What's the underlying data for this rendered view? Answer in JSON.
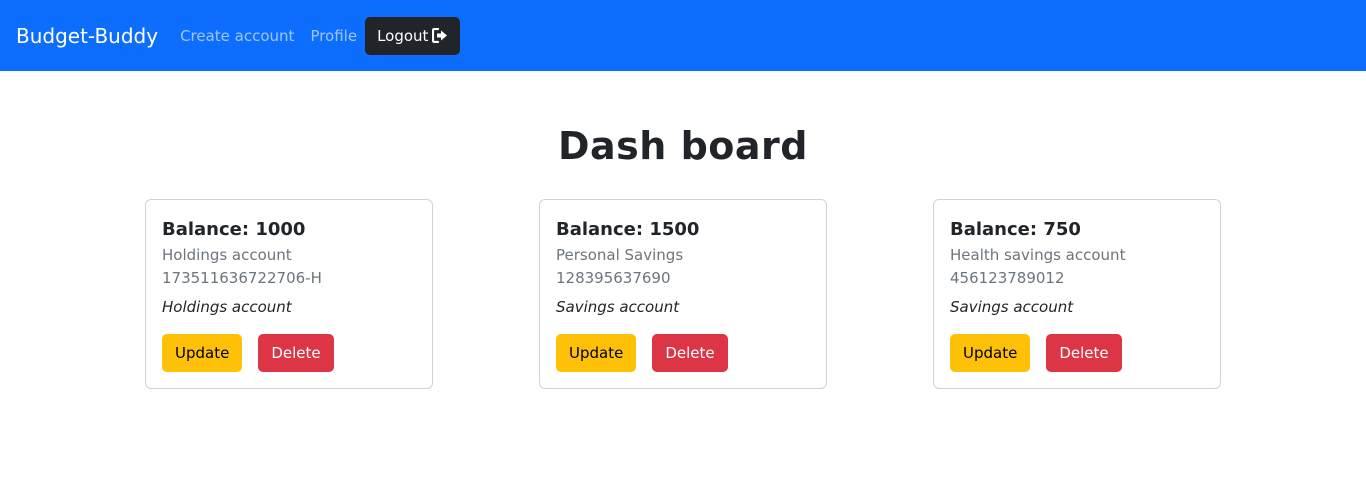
{
  "navbar": {
    "brand": "Budget-Buddy",
    "links": [
      {
        "label": "Create account"
      },
      {
        "label": "Profile"
      }
    ],
    "logout_label": "Logout",
    "logout_icon": "sign-out-icon"
  },
  "page": {
    "title": "Dash board"
  },
  "accounts": [
    {
      "balance": "Balance: 1000",
      "name": "Holdings account",
      "number": "173511636722706-H",
      "type": "Holdings account",
      "update_label": "Update",
      "delete_label": "Delete"
    },
    {
      "balance": "Balance: 1500",
      "name": "Personal Savings",
      "number": "128395637690",
      "type": "Savings account",
      "update_label": "Update",
      "delete_label": "Delete"
    },
    {
      "balance": "Balance: 750",
      "name": "Health savings account",
      "number": "456123789012",
      "type": "Savings account",
      "update_label": "Update",
      "delete_label": "Delete"
    }
  ],
  "colors": {
    "navbar_bg": "#0d6efd",
    "logout_bg": "#212529",
    "update_bg": "#ffc107",
    "delete_bg": "#dc3545"
  }
}
